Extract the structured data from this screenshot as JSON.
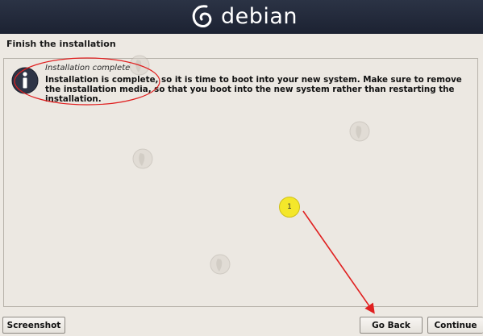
{
  "header": {
    "logo_text": "debian"
  },
  "step": {
    "title": "Finish the installation"
  },
  "notice": {
    "title": "Installation complete",
    "text": "Installation is complete, so it is time to boot into your new system. Make sure to remove the installation media, so that you boot into the new system rather than restarting the installation.",
    "icon": "info-icon"
  },
  "annotations": {
    "callout_number": "1",
    "color": "#e02020"
  },
  "buttons": {
    "screenshot": "Screenshot",
    "go_back": "Go Back",
    "continue": "Continue"
  },
  "colors": {
    "header_bg": "#232a3a",
    "page_bg": "#ede9e3",
    "callout_fill": "#f4e72a"
  }
}
